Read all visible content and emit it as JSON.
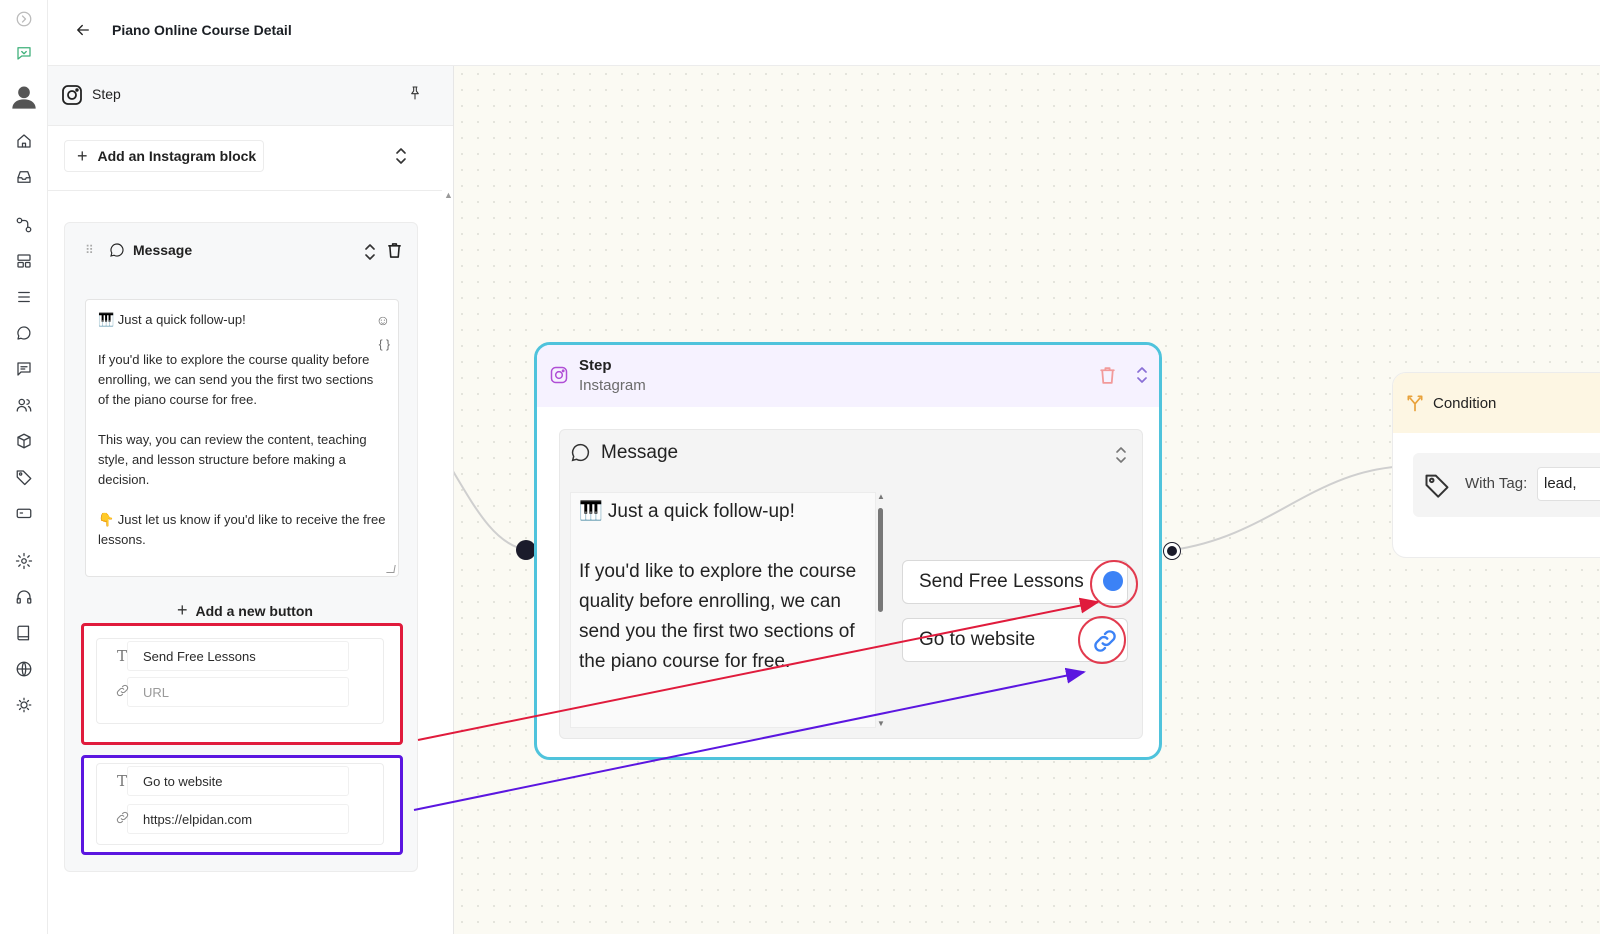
{
  "header": {
    "title": "Piano Online Course Detail",
    "back_icon": "arrow-left-icon"
  },
  "rail": {
    "icons": [
      "collapse-icon",
      "chat-bot-icon",
      "avatar",
      "home-icon",
      "inbox-icon",
      "flow-icon",
      "layout-icon",
      "list-icon",
      "chat-icon",
      "comments-icon",
      "contacts-icon",
      "box-icon",
      "tag-icon",
      "card-icon",
      "settings-icon",
      "headset-icon",
      "book-icon",
      "globe-icon",
      "sun-icon"
    ]
  },
  "panel": {
    "title": "Step",
    "add_block_label": "Add an Instagram block",
    "message": {
      "title": "Message",
      "paragraphs": [
        "🎹 Just a quick follow-up!",
        "If you'd like to explore the course quality before enrolling, we can send you the first two sections of the piano course for free.",
        "This way, you can review the content, teaching style, and lesson structure before making a decision.",
        "👇 Just let us know if you'd like to receive the free lessons."
      ],
      "add_button_label": "Add a new button",
      "buttons": [
        {
          "text": "Send Free Lessons",
          "url": "",
          "url_placeholder": "URL"
        },
        {
          "text": "Go to website",
          "url": "https://elpidan.com",
          "url_placeholder": "URL"
        }
      ]
    }
  },
  "canvas": {
    "step_node": {
      "title": "Step",
      "subtitle": "Instagram",
      "message_title": "Message",
      "paragraphs": [
        "🎹 Just a quick follow-up!",
        "If you'd like to explore the course quality before enrolling, we can send you the first two sections of the piano course for free."
      ],
      "buttons": [
        "Send Free Lessons",
        "Go to website"
      ]
    },
    "condition_node": {
      "title": "Condition",
      "tag_label": "With Tag:",
      "tag_value": "lead,"
    }
  },
  "colors": {
    "highlight_red": "#e01b3c",
    "highlight_purple": "#5b16e0",
    "node_border": "#4fc3dc",
    "link_blue": "#3b82f6"
  }
}
